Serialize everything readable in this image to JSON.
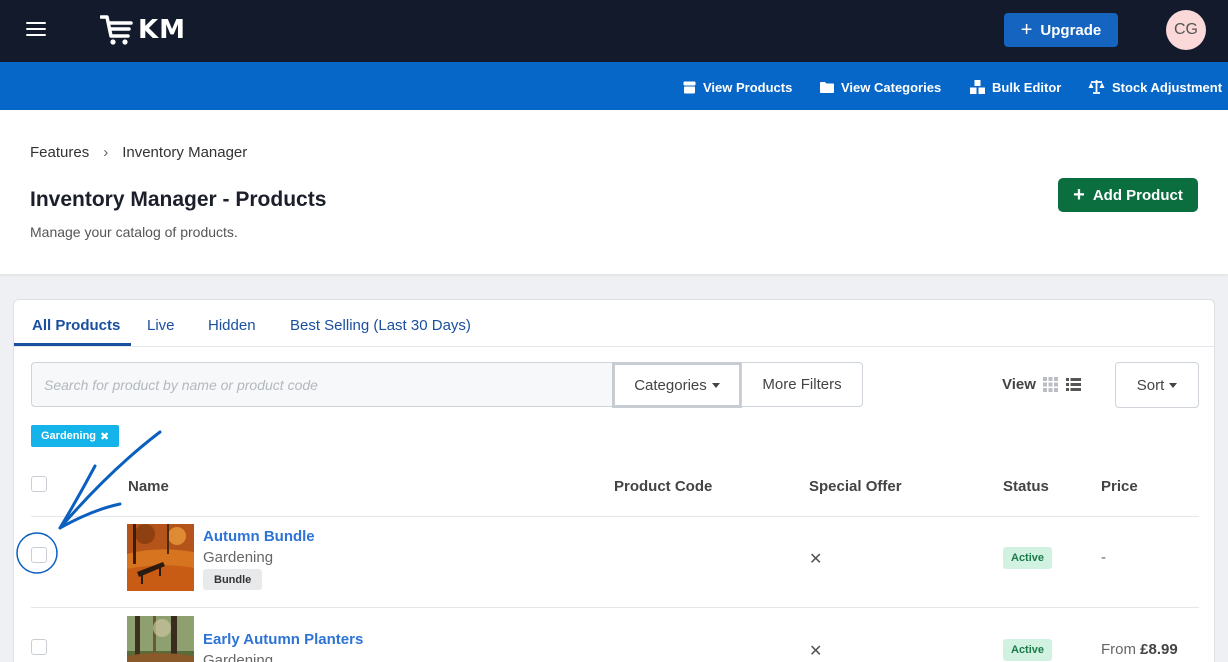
{
  "topbar": {
    "logo_text": "KM",
    "upgrade_label": "Upgrade",
    "avatar_initials": "CG"
  },
  "subnav": {
    "items": [
      {
        "label": "View Products",
        "icon": "box-icon"
      },
      {
        "label": "View Categories",
        "icon": "folder-icon"
      },
      {
        "label": "Bulk Editor",
        "icon": "boxes-icon"
      },
      {
        "label": "Stock Adjustment",
        "icon": "scale-icon"
      }
    ]
  },
  "header": {
    "breadcrumb": [
      "Features",
      "Inventory Manager"
    ],
    "title": "Inventory Manager - Products",
    "subtitle": "Manage your catalog of products.",
    "add_label": "Add Product"
  },
  "tabs": [
    {
      "label": "All Products",
      "active": true
    },
    {
      "label": "Live",
      "active": false
    },
    {
      "label": "Hidden",
      "active": false
    },
    {
      "label": "Best Selling (Last 30 Days)",
      "active": false
    }
  ],
  "filters": {
    "search_placeholder": "Search for product by name or product code",
    "categories_label": "Categories",
    "more_filters_label": "More Filters",
    "view_label": "View",
    "sort_label": "Sort",
    "active_chip": "Gardening"
  },
  "table": {
    "columns": [
      "Name",
      "Product Code",
      "Special Offer",
      "Status",
      "Price"
    ],
    "rows": [
      {
        "name": "Autumn Bundle",
        "category": "Gardening",
        "tag": "Bundle",
        "product_code": "",
        "special_offer": "✕",
        "status": "Active",
        "price_prefix": "",
        "price": "-"
      },
      {
        "name": "Early Autumn Planters",
        "category": "Gardening",
        "tag": "",
        "product_code": "",
        "special_offer": "✕",
        "status": "Active",
        "price_prefix": "From",
        "price": "£8.99"
      }
    ]
  },
  "colors": {
    "topbar": "#121a2b",
    "subnav": "#0767c8",
    "upgrade": "#1565c0",
    "add_button": "#0b6e3f",
    "link": "#2d74d6",
    "chip": "#14b3ea",
    "status_bg": "#d1f2e0",
    "annotation": "#0b5fbf"
  }
}
